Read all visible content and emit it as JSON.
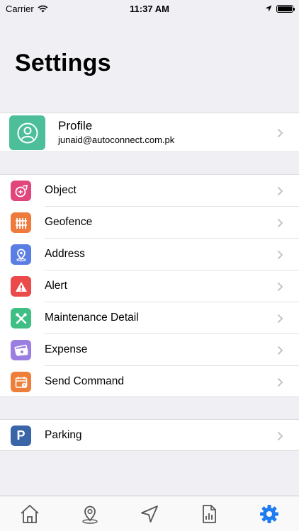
{
  "status_bar": {
    "carrier": "Carrier",
    "time": "11:37 AM"
  },
  "page": {
    "title": "Settings"
  },
  "profile": {
    "name": "Profile",
    "email": "junaid@autoconnect.com.pk",
    "avatar_color": "#4cbf9a"
  },
  "menu": {
    "items": [
      {
        "label": "Object",
        "icon": "object-icon",
        "color": "#e0457b"
      },
      {
        "label": "Geofence",
        "icon": "fence-icon",
        "color": "#ee7a3b"
      },
      {
        "label": "Address",
        "icon": "location-pin-icon",
        "color": "#5b7ee5"
      },
      {
        "label": "Alert",
        "icon": "warning-icon",
        "color": "#ea4a4a"
      },
      {
        "label": "Maintenance Detail",
        "icon": "tools-icon",
        "color": "#3fbf84"
      },
      {
        "label": "Expense",
        "icon": "money-icon",
        "color": "#9a7fe0"
      },
      {
        "label": "Send Command",
        "icon": "calendar-command-icon",
        "color": "#ee7f3b"
      }
    ]
  },
  "parking": {
    "label": "Parking",
    "letter": "P",
    "color": "#3a66a7"
  },
  "tab_bar": {
    "items": [
      "home-icon",
      "location-pin-icon",
      "navigation-arrow-icon",
      "report-icon",
      "settings-gear-icon"
    ],
    "active_color": "#1e7cf2",
    "inactive_color": "#555555"
  }
}
